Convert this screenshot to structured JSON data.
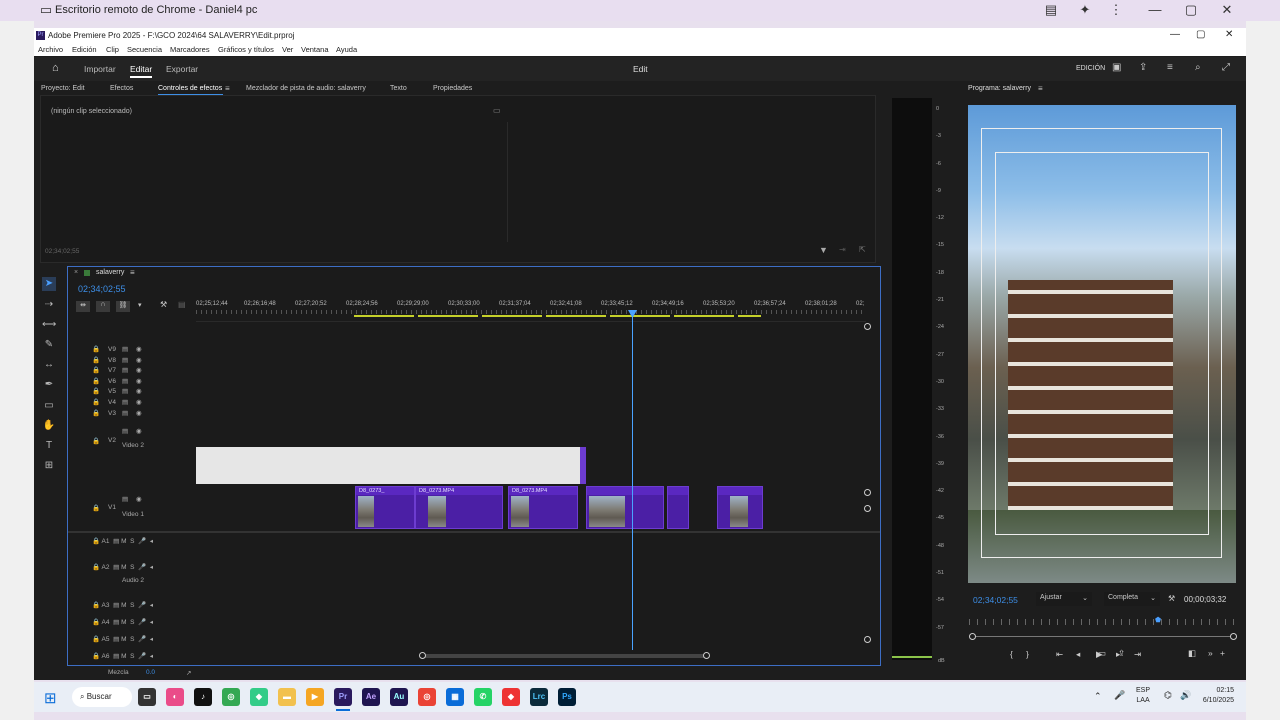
{
  "chrome": {
    "title": "Escritorio remoto de Chrome - Daniel4 pc"
  },
  "premiere": {
    "title": "Adobe Premiere Pro 2025 - F:\\GCO 2024\\64 SALAVERRY\\Edit.prproj",
    "menu": [
      "Archivo",
      "Edición",
      "Clip",
      "Secuencia",
      "Marcadores",
      "Gráficos y títulos",
      "Ver",
      "Ventana",
      "Ayuda"
    ],
    "nav": {
      "import": "Importar",
      "edit": "Editar",
      "export": "Exportar",
      "center": "Edit",
      "workspace": "EDICIÓN"
    },
    "panel_tabs": [
      "Proyecto: Edit",
      "Efectos",
      "Controles de efectos",
      "Mezclador de pista de audio: salaverry",
      "Texto",
      "Propiedades"
    ],
    "active_panel_tab": "Controles de efectos",
    "effects": {
      "no_clip": "(ningún clip seleccionado)",
      "timecode": "02;34;02;55"
    },
    "timeline": {
      "sequence_name": "salaverry",
      "timecode": "02;34;02;55",
      "ruler": [
        "02;25;12;44",
        "02;26;16;48",
        "02;27;20;52",
        "02;28;24;56",
        "02;29;29;00",
        "02;30;33;00",
        "02;31;37;04",
        "02;32;41;08",
        "02;33;45;12",
        "02;34;49;16",
        "02;35;53;20",
        "02;36;57;24",
        "02;38;01;28",
        "02;"
      ],
      "video_tracks": [
        "V9",
        "V8",
        "V7",
        "V6",
        "V5",
        "V4",
        "V3"
      ],
      "v2": {
        "id": "V2",
        "name": "Video 2"
      },
      "v1": {
        "id": "V1",
        "name": "Video 1"
      },
      "clips": [
        {
          "label": "D8_0273_"
        },
        {
          "label": "D8_0273.MP4"
        },
        {
          "label": "D8_0273.MP4"
        }
      ],
      "audio_tracks": [
        "A1",
        "A3",
        "A4",
        "A5",
        "A6"
      ],
      "a2": {
        "id": "A2",
        "name": "Audio 2"
      },
      "track_btns": {
        "m": "M",
        "s": "S"
      },
      "mix": {
        "label": "Mezcla",
        "value": "0.0"
      }
    },
    "meter": {
      "scale": [
        "0",
        "-3",
        "-6",
        "-9",
        "-12",
        "-15",
        "-18",
        "-21",
        "-24",
        "-27",
        "-30",
        "-33",
        "-36",
        "-39",
        "-42",
        "-45",
        "-48",
        "-51",
        "-54",
        "-57"
      ],
      "unit": "dB"
    },
    "program": {
      "title": "Programa: salaverry",
      "timecode": "02;34;02;55",
      "fit": "Ajustar",
      "quality": "Completa",
      "duration": "00;00;03;32"
    }
  },
  "taskbar": {
    "search": "Buscar",
    "lang1": "ESP",
    "lang2": "LAA",
    "time": "02:15",
    "date": "6/10/2025"
  },
  "colors": {
    "accent": "#3d8ee6",
    "clip": "#4b1fa5",
    "playhead": "#4aa3ff"
  }
}
